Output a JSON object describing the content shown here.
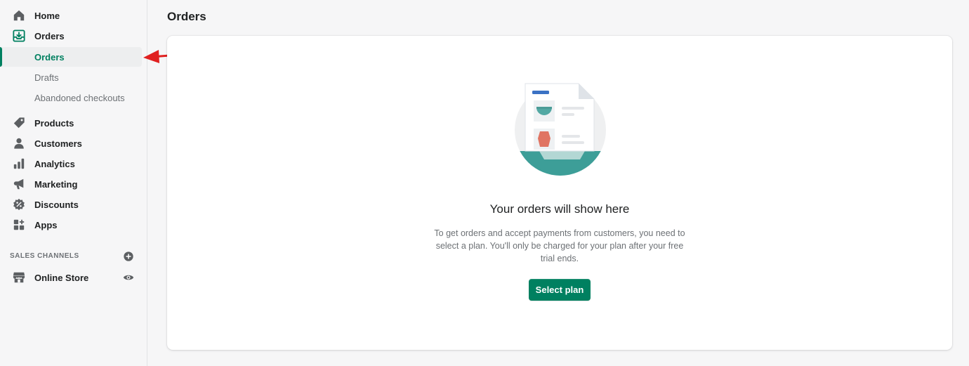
{
  "sidebar": {
    "items": [
      {
        "label": "Home",
        "icon": "home-icon"
      },
      {
        "label": "Orders",
        "icon": "orders-icon"
      },
      {
        "label": "Products",
        "icon": "tag-icon"
      },
      {
        "label": "Customers",
        "icon": "person-icon"
      },
      {
        "label": "Analytics",
        "icon": "bar-chart-icon"
      },
      {
        "label": "Marketing",
        "icon": "megaphone-icon"
      },
      {
        "label": "Discounts",
        "icon": "discount-icon"
      },
      {
        "label": "Apps",
        "icon": "apps-icon"
      }
    ],
    "orders_subitems": [
      {
        "label": "Orders",
        "active": true
      },
      {
        "label": "Drafts"
      },
      {
        "label": "Abandoned checkouts"
      }
    ],
    "sales_channels": {
      "heading": "SALES CHANNELS",
      "items": [
        {
          "label": "Online Store",
          "icon": "store-icon"
        }
      ]
    }
  },
  "page": {
    "title": "Orders",
    "empty_state": {
      "heading": "Your orders will show here",
      "description": "To get orders and accept payments from customers, you need to select a plan. You'll only be charged for your plan after your free trial ends.",
      "button_label": "Select plan"
    }
  },
  "colors": {
    "accent": "#008060",
    "annotation_arrow": "#e02020",
    "illustration_teal": "#3d9e98"
  }
}
